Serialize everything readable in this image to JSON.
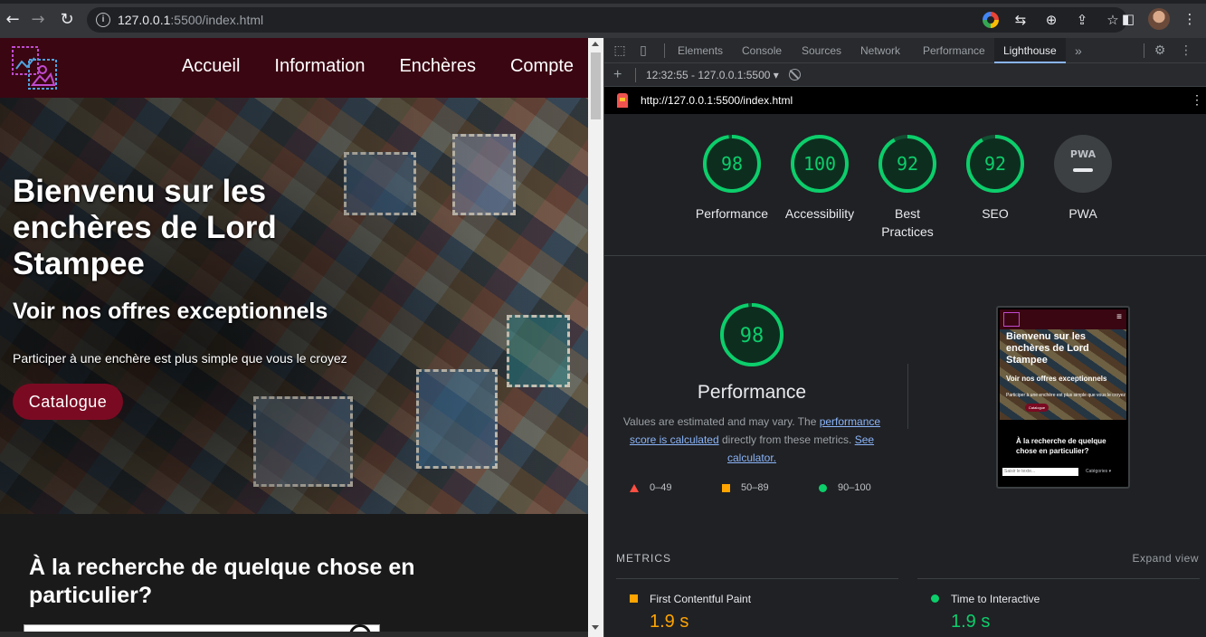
{
  "browser": {
    "url_host": "127.0.0.1",
    "url_rest": ":5500/index.html",
    "icons": [
      "back-icon",
      "forward-icon",
      "reload-icon",
      "info-icon",
      "google-icon",
      "translate-icon",
      "zoom-icon",
      "share-icon",
      "star-icon",
      "sidebar-icon",
      "profile-avatar"
    ]
  },
  "site": {
    "nav": [
      "Accueil",
      "Information",
      "Enchères",
      "Compte"
    ],
    "hero_title": "Bienvenu sur les enchères de Lord Stampee",
    "hero_subtitle": "Voir nos offres exceptionnels",
    "hero_text": "Participer à une enchère est plus simple que vous le croyez",
    "catalogue_button": "Catalogue",
    "search_heading": "À la recherche de quelque chose en particulier?",
    "colors": {
      "header": "#3a0612",
      "button": "#7a0a22"
    }
  },
  "devtools": {
    "tabs": [
      "Elements",
      "Console",
      "Sources",
      "Network",
      "Performance",
      "Lighthouse"
    ],
    "active_tab": "Lighthouse",
    "more": "»",
    "run": "12:32:55 - 127.0.0.1:5500 ▾",
    "report_url": "http://127.0.0.1:5500/index.html",
    "scores": [
      {
        "label": "Performance",
        "value": "98"
      },
      {
        "label": "Accessibility",
        "value": "100"
      },
      {
        "label": "Best Practices",
        "value": "92"
      },
      {
        "label": "SEO",
        "value": "92"
      },
      {
        "label": "PWA",
        "value": "PWA"
      }
    ],
    "score_color": "#0cce6b",
    "big_score": "98",
    "big_title": "Performance",
    "desc_1": "Values are estimated and may vary. The ",
    "desc_link_1": "performance score is calculated",
    "desc_2": " directly from these metrics. ",
    "desc_link_2": "See calculator.",
    "legend": [
      "0–49",
      "50–89",
      "90–100"
    ],
    "thumbnail": {
      "title": "Bienvenu sur les enchères de Lord Stampee",
      "subtitle": "Voir nos offres exceptionnels",
      "text": "Participer à une enchère est plus simple que vous le croyez",
      "button": "Catalogue",
      "question": "À la recherche de quelque chose en particulier?",
      "search_placeholder": "Saisir le texte...",
      "category": "Catégories ▾"
    },
    "metrics_heading": "METRICS",
    "expand_view": "Expand view",
    "metrics": [
      {
        "name": "First Contentful Paint",
        "value": "1.9 s",
        "color": "#ffa400"
      },
      {
        "name": "Time to Interactive",
        "value": "1.9 s",
        "color": "#0cce6b"
      }
    ]
  }
}
